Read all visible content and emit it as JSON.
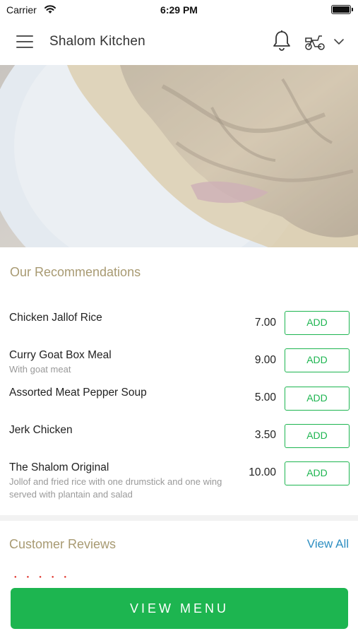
{
  "status_bar": {
    "carrier": "Carrier",
    "time": "6:29 PM"
  },
  "header": {
    "title": "Shalom Kitchen",
    "icons": [
      "menu-icon",
      "bell-icon",
      "scooter-icon",
      "chevron-down-icon"
    ]
  },
  "recommendations": {
    "title": "Our Recommendations",
    "add_label": "ADD",
    "items": [
      {
        "name": "Chicken Jallof Rice",
        "desc": "",
        "price": "7.00"
      },
      {
        "name": "Curry Goat Box Meal",
        "desc": "With goat meat",
        "price": "9.00"
      },
      {
        "name": "Assorted Meat Pepper Soup",
        "desc": "",
        "price": "5.00"
      },
      {
        "name": "Jerk Chicken",
        "desc": "",
        "price": "3.50"
      },
      {
        "name": "The Shalom Original",
        "desc": "Jollof and fried rice with one drumstick and one wing served with plantain and salad",
        "price": "10.00"
      }
    ]
  },
  "reviews": {
    "title": "Customer Reviews",
    "view_all": "View All"
  },
  "footer": {
    "view_menu": "VIEW MENU"
  },
  "colors": {
    "accent_green": "#1db550",
    "section_title": "#a89a72",
    "link_blue": "#2f8fc2",
    "star_red": "#e0332b"
  }
}
